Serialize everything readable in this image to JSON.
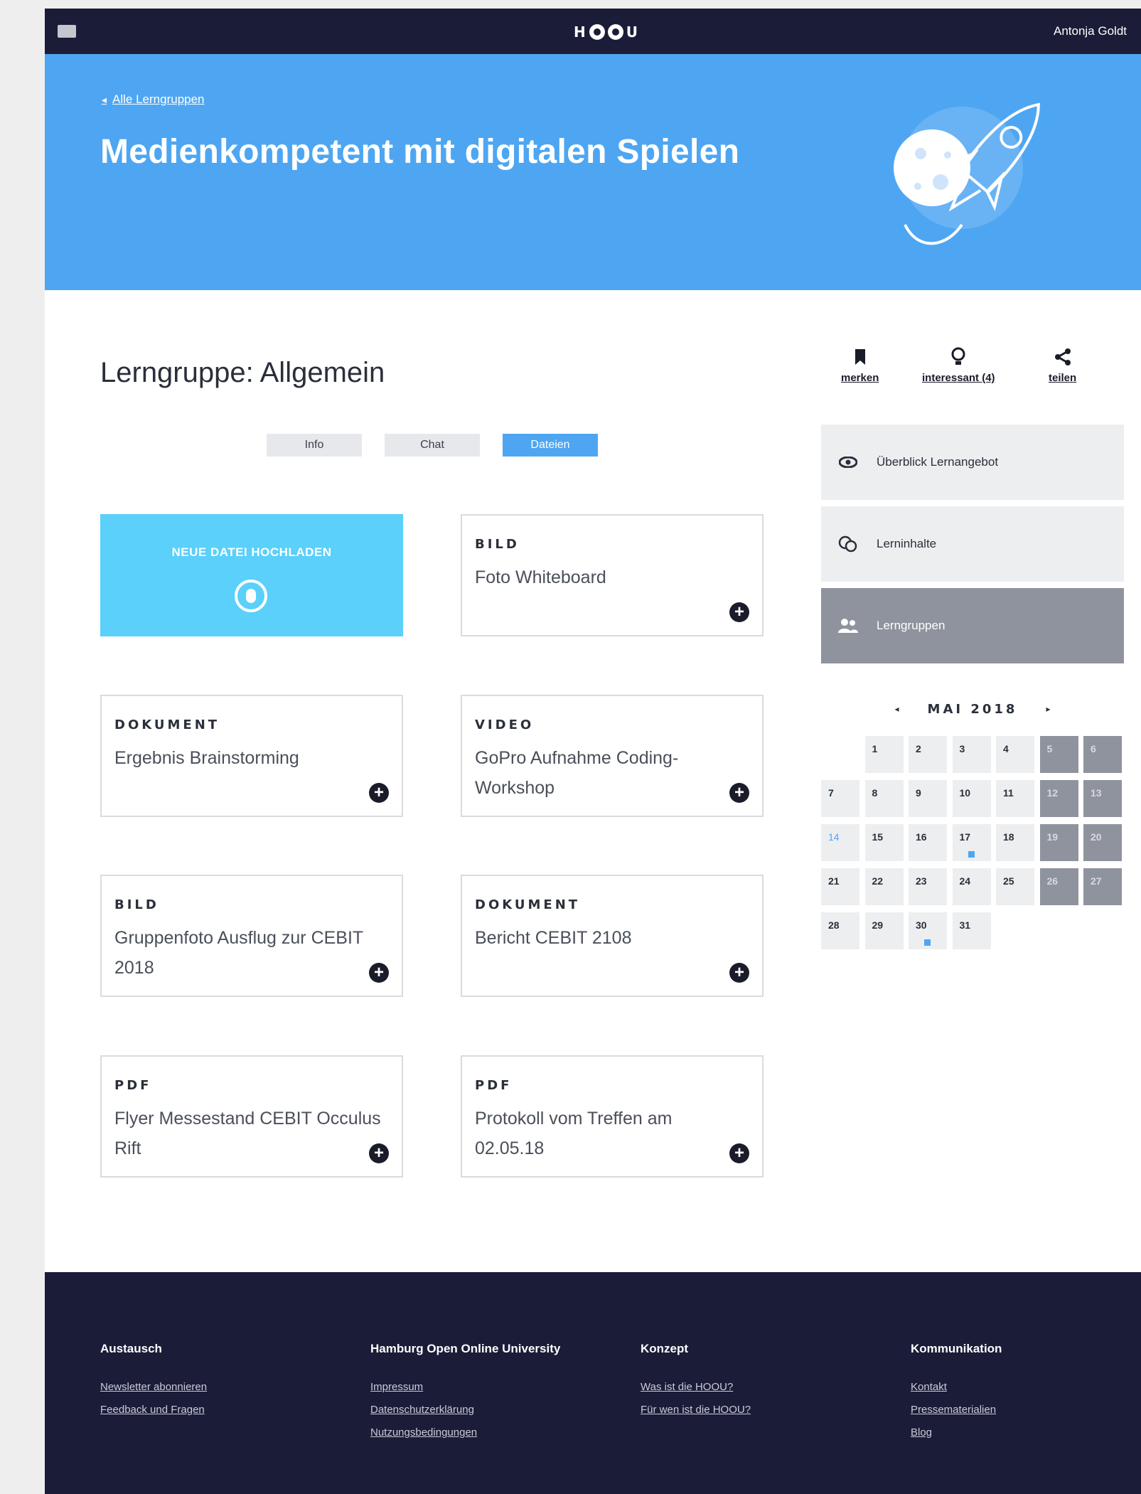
{
  "topbar": {
    "logo_letters": [
      "H",
      "U"
    ],
    "user_name": "Antonja Goldt"
  },
  "hero": {
    "back_link": "Alle Lerngruppen",
    "title": "Medienkompetent mit digitalen Spielen"
  },
  "main": {
    "page_title": "Lerngruppe: Allgemein",
    "tabs": [
      {
        "label": "Info",
        "active": false
      },
      {
        "label": "Chat",
        "active": false
      },
      {
        "label": "Dateien",
        "active": true
      }
    ],
    "upload": {
      "label": "NEUE DATEI HOCHLADEN"
    },
    "cards": [
      {
        "type": "BILD",
        "title": "Foto Whiteboard"
      },
      {
        "type": "DOKUMENT",
        "title": "Ergebnis Brainstorming"
      },
      {
        "type": "VIDEO",
        "title": "GoPro Aufnahme Coding-Workshop"
      },
      {
        "type": "BILD",
        "title": "Gruppenfoto Ausflug zur CEBIT 2018"
      },
      {
        "type": "DOKUMENT",
        "title": "Bericht CEBIT 2108"
      },
      {
        "type": "PDF",
        "title": "Flyer Messestand CEBIT Occulus Rift"
      },
      {
        "type": "PDF",
        "title": "Protokoll vom Treffen am 02.05.18"
      }
    ]
  },
  "actions": {
    "bookmark": "merken",
    "interesting": "interessant (4)",
    "share": "teilen"
  },
  "side_nav": [
    {
      "label": "Überblick Lernangebot",
      "icon": "eye-icon",
      "active": false
    },
    {
      "label": "Lerninhalte",
      "icon": "bubbles-icon",
      "active": false
    },
    {
      "label": "Lerngruppen",
      "icon": "users-icon",
      "active": true
    }
  ],
  "calendar": {
    "month_label": "MAI 2018",
    "prev": "◂",
    "next": "▸",
    "today": 14,
    "event_days": [
      17,
      30
    ],
    "weeks": [
      [
        "",
        "1",
        "2",
        "3",
        "4",
        "5",
        "6"
      ],
      [
        "7",
        "8",
        "9",
        "10",
        "11",
        "12",
        "13"
      ],
      [
        "14",
        "15",
        "16",
        "17",
        "18",
        "19",
        "20"
      ],
      [
        "21",
        "22",
        "23",
        "24",
        "25",
        "26",
        "27"
      ],
      [
        "28",
        "29",
        "30",
        "31",
        "",
        "",
        ""
      ]
    ]
  },
  "footer": {
    "columns": [
      {
        "title": "Austausch",
        "links": [
          "Newsletter abonnieren",
          "Feedback und Fragen"
        ]
      },
      {
        "title": "Hamburg Open Online University",
        "links": [
          "Impressum",
          "Datenschutzerklärung",
          "Nutzungsbedingungen"
        ]
      },
      {
        "title": "Konzept",
        "links": [
          "Was ist die HOOU?",
          "Für wen ist die HOOU?"
        ]
      },
      {
        "title": "Kommunikation",
        "links": [
          "Kontakt",
          "Pressematerialien",
          "Blog"
        ]
      }
    ]
  },
  "colors": {
    "navy": "#1b1c38",
    "hero_blue": "#4ea6f2",
    "upload_cyan": "#5ad0fb",
    "sidebar_active": "#8f939e"
  }
}
